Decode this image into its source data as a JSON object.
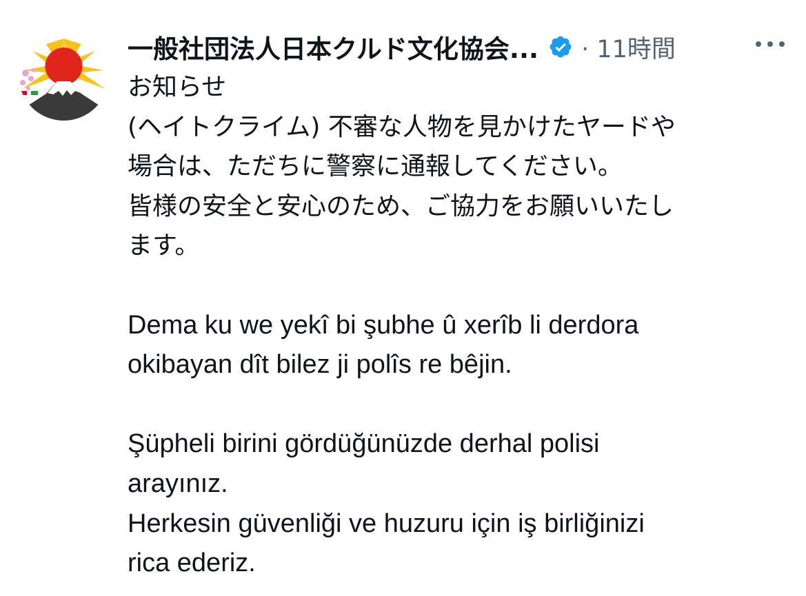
{
  "author": {
    "name": "一般社団法人日本クルド文化協会...",
    "verified_icon": "verified-badge-icon",
    "avatar_icon": "mount-fuji-rising-sun-avatar"
  },
  "meta": {
    "separator_time": "· 11時間"
  },
  "more_icon": "more-options-icon",
  "colors": {
    "text": "#0f1419",
    "secondary": "#536471",
    "verified": "#1d9bf0"
  },
  "tweet": {
    "lines": [
      "お知らせ",
      "(ヘイトクライム) 不審な人物を見かけたヤードや",
      "場合は、ただちに警察に通報してください。",
      "皆様の安全と安心のため、ご協力をお願いいたし",
      "ます。",
      "",
      "Dema ku we yekî bi şubhe û xerîb li derdora",
      "okibayan dît bilez ji polîs re bêjin.",
      "",
      "Şüpheli birini gördüğünüzde derhal polisi",
      "arayınız.",
      "Herkesin güvenliği ve huzuru için iş birliğinizi",
      "rica ederiz."
    ]
  }
}
